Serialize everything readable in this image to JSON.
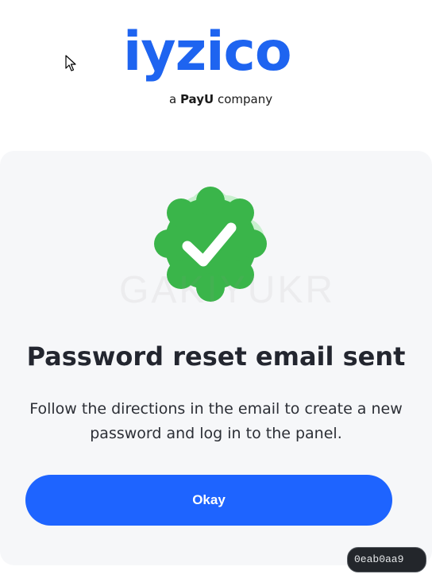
{
  "logo": {
    "wordmark": "iyzico",
    "tagline_prefix": "a ",
    "tagline_brand": "PayU",
    "tagline_suffix": " company",
    "brand_color": "#1e64f0"
  },
  "watermark": "GAKIYUKR",
  "status_icon": {
    "name": "check-badge-icon",
    "color": "#3ab54a",
    "halo_color": "#c9f0cf"
  },
  "message": {
    "title": "Password reset email sent",
    "body": "Follow the directions in the email to create a new password and log in to the panel."
  },
  "actions": {
    "okay_label": "Okay",
    "button_color": "#1e64ff"
  },
  "footer": {
    "hash": "0eab0aa9"
  }
}
